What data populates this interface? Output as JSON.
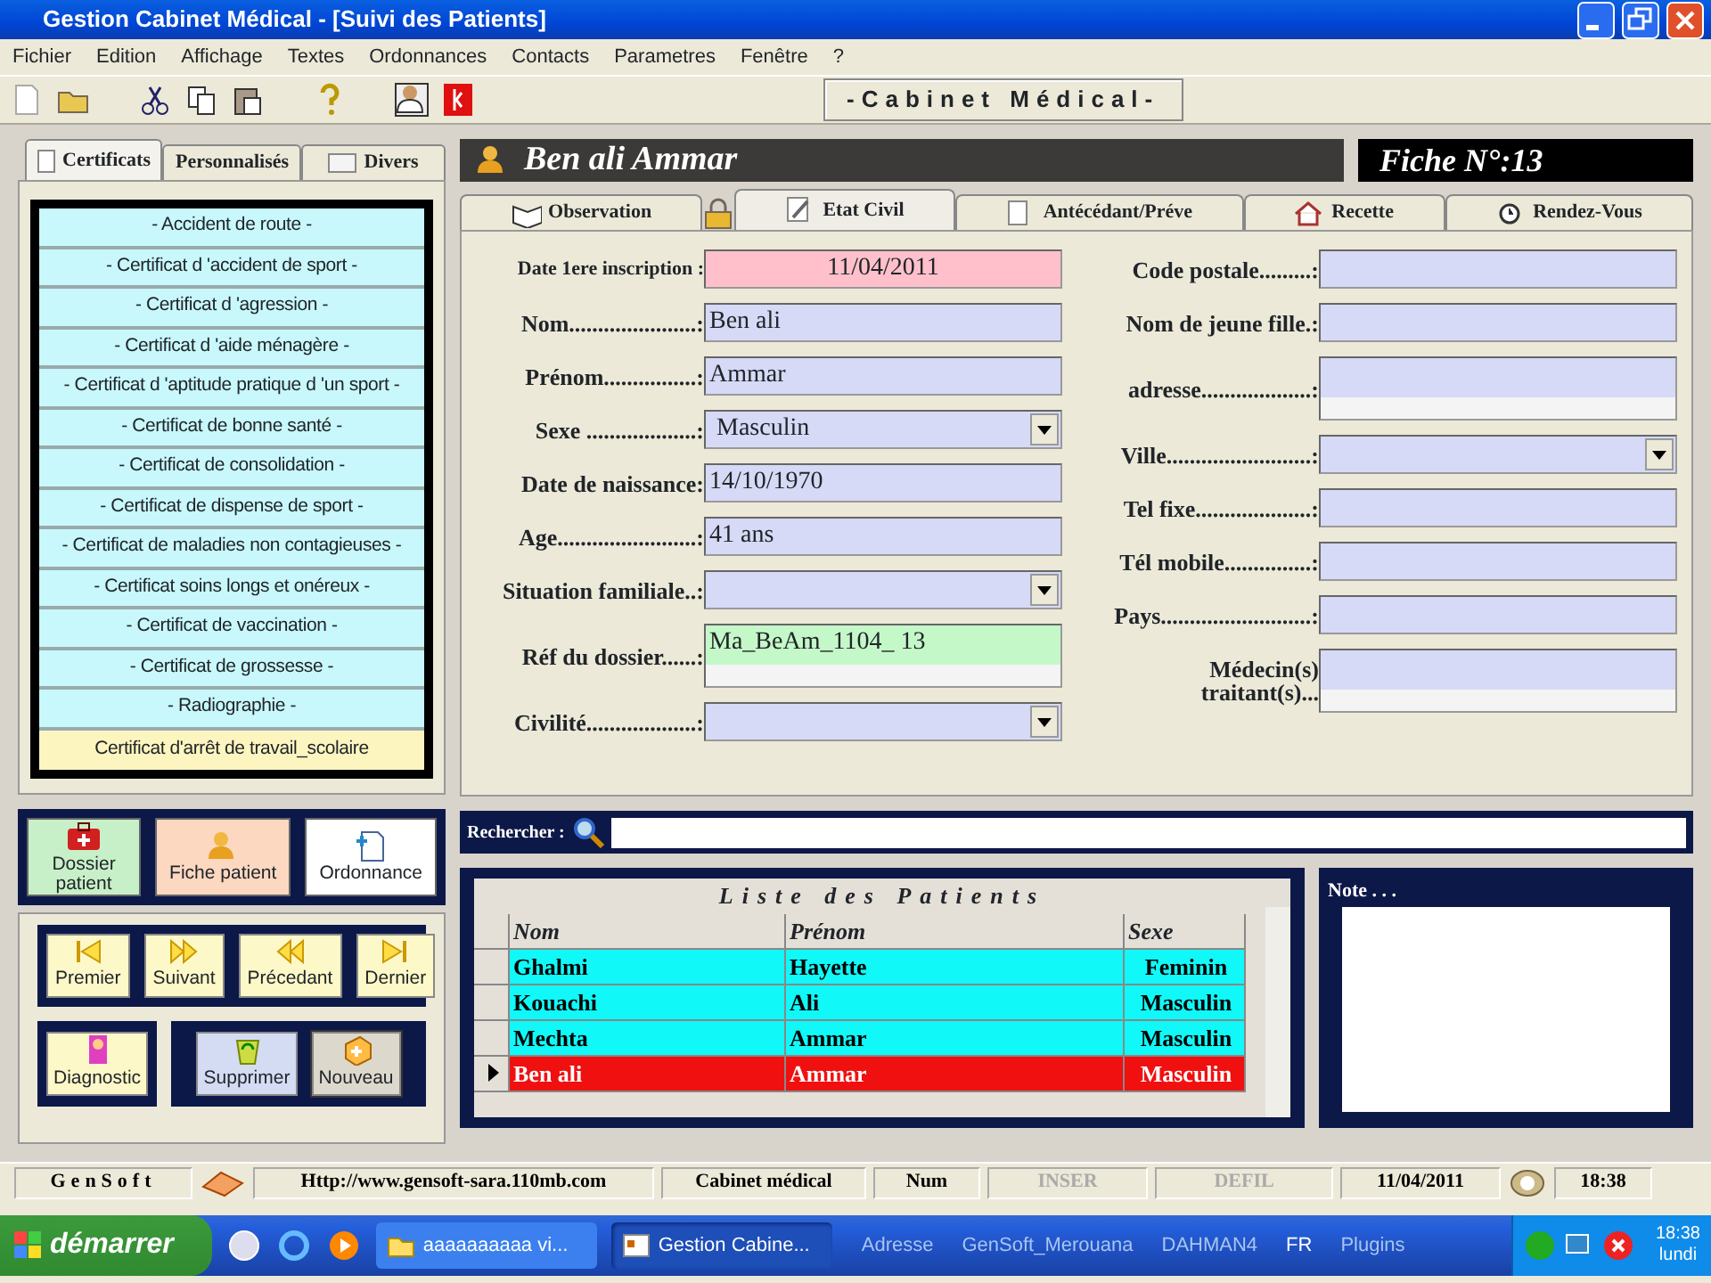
{
  "window": {
    "title": "Gestion Cabinet Médical - [Suivi des Patients]"
  },
  "menu": [
    "Fichier",
    "Edition",
    "Affichage",
    "Textes",
    "Ordonnances",
    "Contacts",
    "Parametres",
    "Fenêtre",
    "?"
  ],
  "toolbar": {
    "banner": "-Cabinet Médical-"
  },
  "left_tabs": [
    {
      "label": "Certificats",
      "selected": true
    },
    {
      "label": "Personnalisés",
      "selected": false
    },
    {
      "label": "Divers",
      "selected": false
    }
  ],
  "certificates": [
    {
      "label": "- Accident de route -",
      "selected": false
    },
    {
      "label": "- Certificat d 'accident de sport -",
      "selected": false
    },
    {
      "label": "- Certificat d 'agression -",
      "selected": false
    },
    {
      "label": "- Certificat d 'aide ménagère -",
      "selected": false
    },
    {
      "label": "- Certificat d 'aptitude pratique d 'un sport -",
      "selected": false
    },
    {
      "label": "- Certificat de bonne santé -",
      "selected": false
    },
    {
      "label": "- Certificat de consolidation -",
      "selected": false
    },
    {
      "label": "- Certificat de dispense de sport -",
      "selected": false
    },
    {
      "label": "- Certificat de maladies non contagieuses -",
      "selected": false
    },
    {
      "label": "- Certificat soins longs et onéreux -",
      "selected": false
    },
    {
      "label": "- Certificat de vaccination -",
      "selected": false
    },
    {
      "label": "- Certificat de grossesse -",
      "selected": false
    },
    {
      "label": "- Radiographie -",
      "selected": false
    },
    {
      "label": "Certificat d'arrêt  de travail_scolaire",
      "selected": true
    }
  ],
  "patient_header": {
    "name": "Ben ali Ammar",
    "fiche": "Fiche N°:13"
  },
  "tabs": [
    {
      "label": "Observation",
      "selected": false
    },
    {
      "label": "Etat Civil",
      "selected": true
    },
    {
      "label": "Antécédant/Préve",
      "selected": false
    },
    {
      "label": "Recette",
      "selected": false
    },
    {
      "label": "Rendez-Vous",
      "selected": false
    }
  ],
  "form_left": [
    {
      "label": "Date 1ere inscription :",
      "kind": "text",
      "value": "11/04/2011",
      "color": "#ffc0cb"
    },
    {
      "label": "Nom......................:",
      "kind": "text",
      "value": "Ben ali",
      "color": "#d6daf6"
    },
    {
      "label": "Prénom................:",
      "kind": "text",
      "value": "Ammar",
      "color": "#d6daf6"
    },
    {
      "label": "Sexe ...................:",
      "kind": "combo",
      "value": "Masculin",
      "color": "#d6daf6"
    },
    {
      "label": "Date de naissance:",
      "kind": "text",
      "value": "14/10/1970",
      "color": "#d6daf6"
    },
    {
      "label": "Age........................:",
      "kind": "text",
      "value": "41 ans",
      "color": "#d6daf6"
    },
    {
      "label": "Situation familiale..:",
      "kind": "combo",
      "color": "#d6daf6"
    },
    {
      "label": "Réf du dossier......:",
      "kind": "memo",
      "value": "Ma_BeAm_1104_ 13",
      "color": "#c4f8c8"
    },
    {
      "label": "Civilité...................:",
      "kind": "combo",
      "color": "#d6daf6"
    }
  ],
  "form_right": [
    {
      "label": "Code postale.........:",
      "kind": "text",
      "color": "#d6daf6"
    },
    {
      "label": "Nom de jeune fille.:",
      "kind": "text",
      "color": "#d6daf6"
    },
    {
      "label": "adresse...................:",
      "kind": "memo",
      "color": "#d6daf6"
    },
    {
      "label": "Ville.........................:",
      "kind": "combo",
      "color": "#d6daf6"
    },
    {
      "label": "Tel fixe....................:",
      "kind": "text",
      "color": "#d6daf6"
    },
    {
      "label": "Tél mobile...............:",
      "kind": "text",
      "color": "#d6daf6"
    },
    {
      "label": "Pays..........................:",
      "kind": "text",
      "color": "#d6daf6"
    },
    {
      "label": "Médecin(s) traitant(s)...",
      "kind": "memo",
      "color": "#d6daf6"
    }
  ],
  "action_buttons": [
    {
      "label": "Dossier patient",
      "color": "#c8f0c8"
    },
    {
      "label": "Fiche patient",
      "color": "#fcd8c0"
    },
    {
      "label": "Ordonnance",
      "color": "#ffffff"
    }
  ],
  "nav_buttons": [
    "Premier",
    "Suivant",
    "Précedant",
    "Dernier"
  ],
  "record_buttons": [
    {
      "label": "Diagnostic",
      "kind": "diagnostic"
    },
    {
      "label": "Supprimer",
      "kind": "delete"
    },
    {
      "label": "Nouveau",
      "kind": "new"
    }
  ],
  "search": {
    "label": "Rechercher :"
  },
  "patients": {
    "title": "Liste des Patients",
    "columns": [
      "Nom",
      "Prénom",
      "Sexe"
    ],
    "rows": [
      {
        "cells": [
          "Ghalmi",
          "Hayette",
          "Feminin"
        ],
        "selected": false
      },
      {
        "cells": [
          "Kouachi",
          "Ali",
          "Masculin"
        ],
        "selected": false
      },
      {
        "cells": [
          "Mechta",
          "Ammar",
          "Masculin"
        ],
        "selected": false
      },
      {
        "cells": [
          "Ben ali",
          "Ammar",
          "Masculin"
        ],
        "selected": true
      }
    ]
  },
  "note": {
    "label": "Note . . ."
  },
  "status_bar": [
    {
      "text": "GenSoft",
      "disabled": false
    },
    {
      "text": "Http://www.gensoft-sara.110mb.com",
      "disabled": false
    },
    {
      "text": "Cabinet médical",
      "disabled": false
    },
    {
      "text": "Num",
      "disabled": false
    },
    {
      "text": "INSER",
      "disabled": true
    },
    {
      "text": "DEFIL",
      "disabled": true
    },
    {
      "text": "11/04/2011",
      "disabled": false
    },
    {
      "text": "18:38",
      "disabled": false
    }
  ],
  "taskbar": {
    "start": "démarrer",
    "tasks": [
      {
        "label": "aaaaaaaaaa vi...",
        "selected": false
      },
      {
        "label": "Gestion Cabine...",
        "selected": true
      }
    ],
    "toolbars": [
      "Adresse",
      "GenSoft_Merouana",
      "DAHMAN4",
      "FR",
      "Plugins"
    ],
    "time": "18:38",
    "day": "lundi"
  }
}
